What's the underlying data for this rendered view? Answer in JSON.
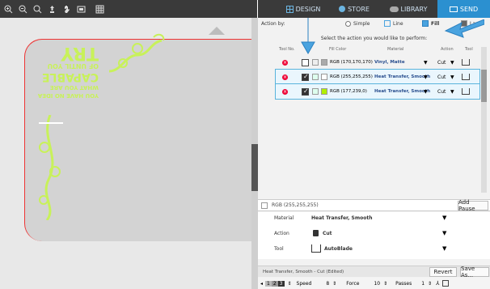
{
  "toolbar": {
    "icons": [
      "zoom-in-icon",
      "zoom-out-icon",
      "zoom-fit-icon",
      "pan-icon",
      "hand-icon",
      "fit-to-window-icon",
      "grid-icon"
    ]
  },
  "tabs": [
    {
      "label": "DESIGN",
      "icon": "grid-icon"
    },
    {
      "label": "STORE",
      "icon": "store-icon"
    },
    {
      "label": "LIBRARY",
      "icon": "cloud-icon"
    },
    {
      "label": "SEND",
      "icon": "send-icon"
    }
  ],
  "action_by": {
    "label": "Action by:",
    "options": [
      {
        "label": "Simple",
        "selected": false
      },
      {
        "label": "Line",
        "selected": false
      },
      {
        "label": "Fill",
        "selected": true
      },
      {
        "label": "Layer",
        "selected": false
      }
    ]
  },
  "instruction": "Select the action you would like to perform:",
  "table": {
    "headers": [
      "Tool No.",
      "Fill Color",
      "Material",
      "Action",
      "Tool"
    ],
    "rows": [
      {
        "checked": false,
        "color": "RGB (170,170,170)",
        "swatch": "#aaaaaa",
        "material": "Vinyl, Matte",
        "action": "Cut",
        "selected": false
      },
      {
        "checked": true,
        "color": "RGB (255,255,255)",
        "swatch": "#ffffff",
        "material": "Heat Transfer, Smooth",
        "action": "Cut",
        "selected": true
      },
      {
        "checked": true,
        "color": "RGB (177,239,0)",
        "swatch": "#b1ef00",
        "material": "Heat Transfer, Smooth",
        "action": "Cut",
        "selected": true
      }
    ]
  },
  "detail": {
    "title": "RGB (255,255,255)",
    "add_pause": "Add Pause",
    "material_label": "Material",
    "material_value": "Heat Transfer, Smooth",
    "action_label": "Action",
    "action_value": "Cut",
    "tool_label": "Tool",
    "tool_value": "AutoBlade"
  },
  "footer": {
    "preset": "Heat Transfer, Smooth - Cut (Edited)",
    "revert": "Revert",
    "save_as": "Save As...",
    "blade_values": [
      "1",
      "2",
      "3"
    ],
    "speed_label": "Speed",
    "speed_value": "8",
    "force_label": "Force",
    "force_value": "10",
    "passes_label": "Passes",
    "passes_value": "1"
  },
  "design": {
    "lines": [
      "YOU HAVE NO IDEA",
      "WHAT YOU ARE",
      "CAPABLE",
      "OF UNTIL YOU",
      "TRY"
    ],
    "color": "#c8f15a"
  }
}
